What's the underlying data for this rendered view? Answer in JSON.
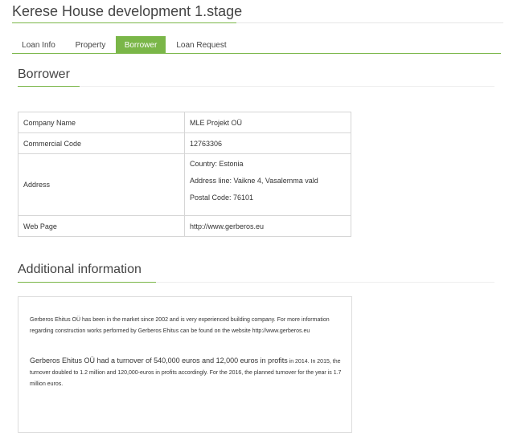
{
  "page": {
    "title": "Kerese House development 1.stage"
  },
  "tabs": [
    {
      "label": "Loan Info"
    },
    {
      "label": "Property"
    },
    {
      "label": "Borrower"
    },
    {
      "label": "Loan Request"
    }
  ],
  "active_tab": "Borrower",
  "accent_color": "#7ab648",
  "borrower": {
    "heading": "Borrower",
    "rows": {
      "company_name": {
        "label": "Company Name",
        "value": "MLE Projekt OÜ"
      },
      "commercial_code": {
        "label": "Commercial Code",
        "value": "12763306"
      },
      "address": {
        "label": "Address",
        "country": "Country: Estonia",
        "address_line": "Address line: Vaikne 4, Vasalemma vald",
        "postal_code": "Postal Code: 76101"
      },
      "web_page": {
        "label": "Web Page",
        "value": "http://www.gerberos.eu"
      }
    }
  },
  "additional": {
    "heading": "Additional information",
    "paragraph1": "Gerberos Ehitus OÜ has been in the market since 2002 and is very experienced building company. For more information regarding construction works performed by Gerberos Ehitus can be found on the website http://www.gerberos.eu",
    "paragraph2_lead": "Gerberos Ehitus OÜ had a turnover of 540,000 euros and 12,000 euros in profits",
    "paragraph2_rest": " in 2014. In 2015, the turnover doubled to 1.2 million and 120,000-euros in profits accordingly. For the 2016, the planned turnover for the year is 1.7 million euros."
  }
}
